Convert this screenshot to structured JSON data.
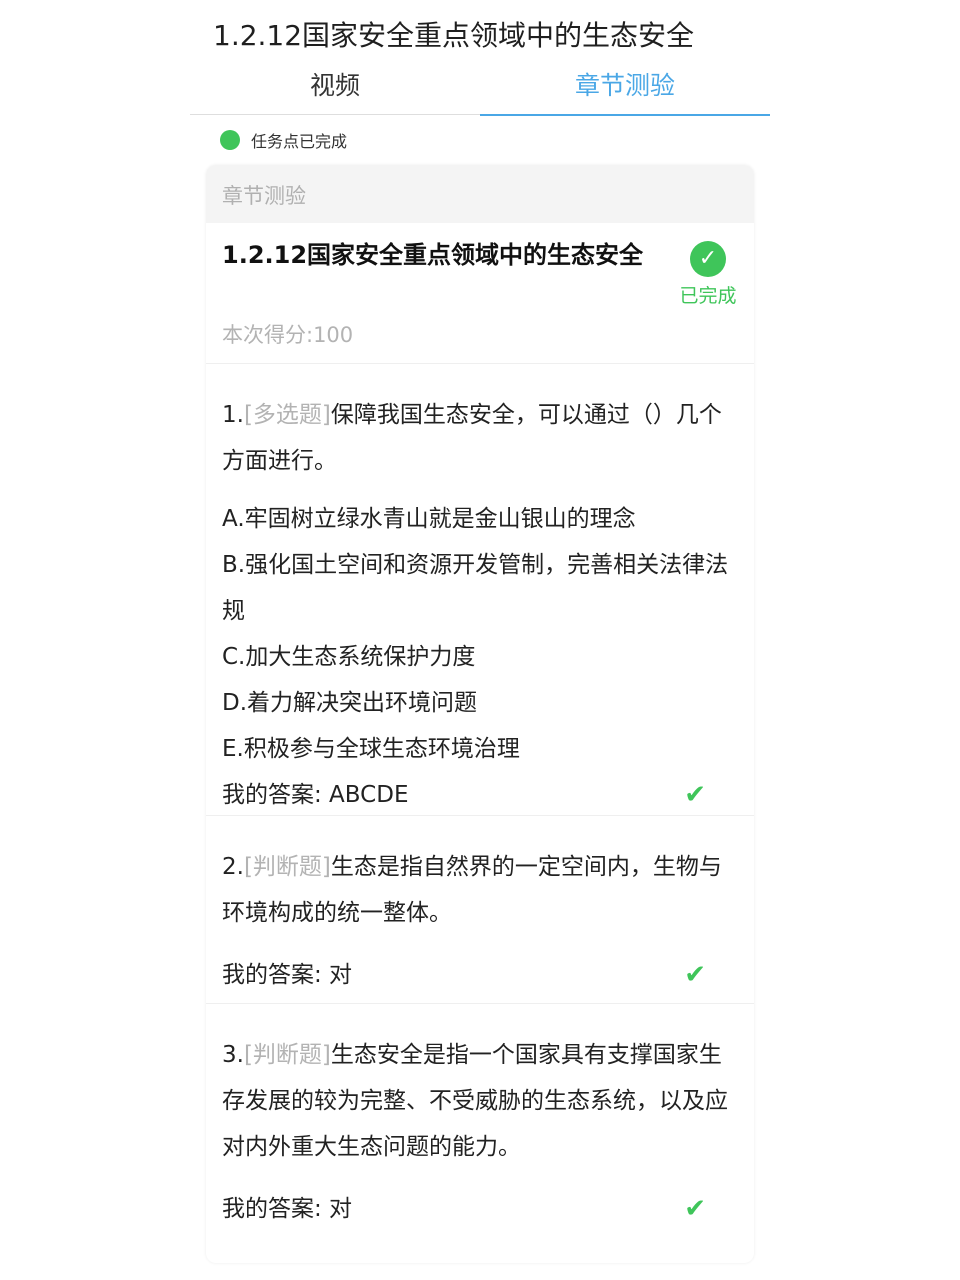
{
  "page_title": "1.2.12国家安全重点领域中的生态安全",
  "tabs": [
    {
      "label": "视频",
      "active": false
    },
    {
      "label": "章节测验",
      "active": true
    }
  ],
  "task_status": "任务点已完成",
  "card": {
    "header": "章节测验",
    "quiz_title": "1.2.12国家安全重点领域中的生态安全",
    "score": "本次得分:100",
    "status_label": "已完成"
  },
  "questions": [
    {
      "number": "1.",
      "type": "[多选题]",
      "text": "保障我国生态安全，可以通过（）几个方面进行。",
      "options": [
        "A.牢固树立绿水青山就是金山银山的理念",
        "B.强化国土空间和资源开发管制，完善相关法律法规",
        "C.加大生态系统保护力度",
        "D.着力解决突出环境问题",
        "E.积极参与全球生态环境治理"
      ],
      "answer": "我的答案: ABCDE"
    },
    {
      "number": "2.",
      "type": "[判断题]",
      "text": "生态是指自然界的一定空间内，生物与环境构成的统一整体。",
      "answer": "我的答案: 对"
    },
    {
      "number": "3.",
      "type": "[判断题]",
      "text": "生态安全是指一个国家具有支撑国家生存发展的较为完整、不受威胁的生态系统，以及应对内外重大生态问题的能力。",
      "answer": "我的答案: 对"
    }
  ],
  "colors": {
    "accent_blue": "#4aa7e6",
    "success_green": "#3fc55a",
    "muted_gray": "#b3b3b3"
  }
}
